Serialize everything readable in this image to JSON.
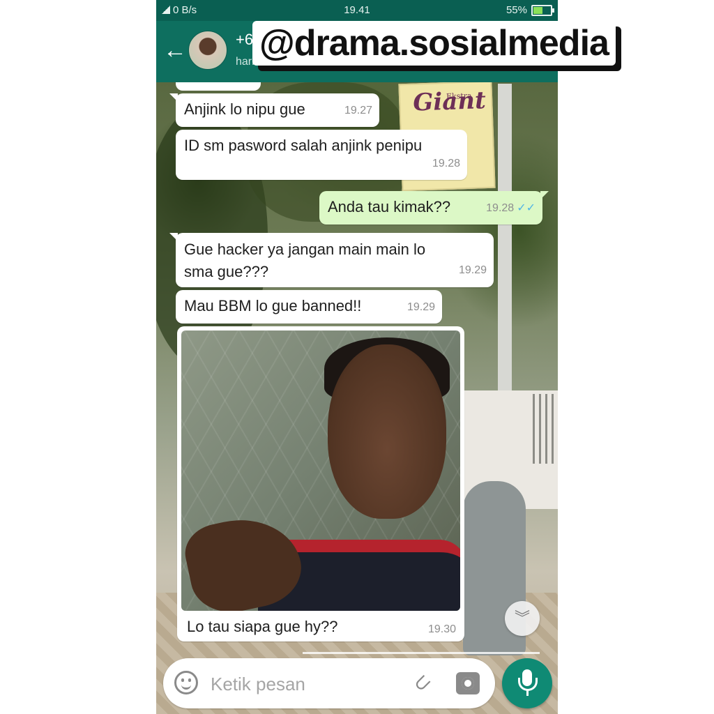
{
  "status_bar": {
    "network": "0 B/s",
    "time": "19.41",
    "battery": "55%",
    "battery_level": 0.55
  },
  "header": {
    "contact_name": "+6",
    "last_seen": "hari ini pukul 19.30"
  },
  "watermark": "@drama.sosialmedia",
  "messages": [
    {
      "text": "Anjink lo nipu gue",
      "time": "19.27"
    },
    {
      "text": "ID sm pasword salah anjink penipu",
      "time": "19.28"
    },
    {
      "text": "Anda tau kimak??",
      "time": "19.28",
      "ticks": "✓✓"
    },
    {
      "text": "Gue hacker ya jangan main main lo",
      "text2": "sma gue???",
      "time": "19.29"
    },
    {
      "text": "Mau BBM lo gue banned!!",
      "time": "19.29"
    }
  ],
  "image_message": {
    "caption": "Lo tau siapa gue hy??",
    "time": "19.30"
  },
  "input": {
    "placeholder": "Ketik pesan"
  },
  "icons": [
    "back-arrow-icon",
    "emoji-icon",
    "attach-icon",
    "camera-icon",
    "mic-icon",
    "chevron-down-icon"
  ],
  "colors": {
    "header": "#0e6f5f",
    "status_bar": "#0a5f52",
    "outgoing_bubble": "#dcf8c6",
    "read_ticks": "#4fb4e6",
    "mic_button": "#0f8a74"
  }
}
